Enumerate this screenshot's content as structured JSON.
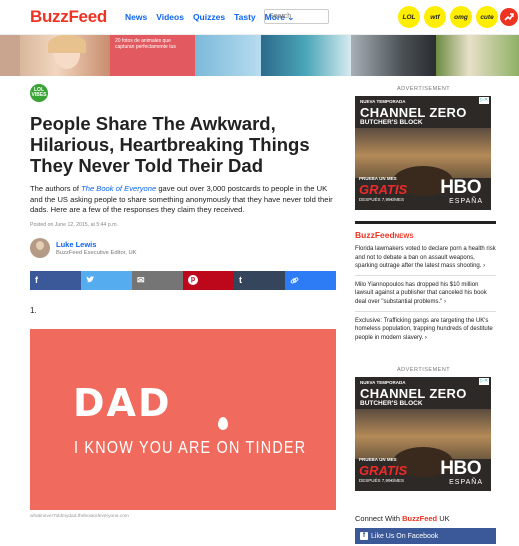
{
  "header": {
    "logo": "BuzzFeed",
    "nav": [
      "News",
      "Videos",
      "Quizzes",
      "Tasty",
      "More ⌄"
    ],
    "search_placeholder": "Search",
    "badges": [
      "LOL",
      "wtf",
      "omg",
      "cute"
    ],
    "colors": {
      "brand": "#ee3322",
      "link": "#0f65ef",
      "badge": "#ffee00"
    }
  },
  "strip": {
    "caption": "20 fotos de animales que capturan perfectamente tus"
  },
  "article": {
    "badge": "LOL VIBES",
    "title": "People Share The Awkward, Hilarious, Heartbreaking Things They Never Told Their Dad",
    "dek_before": "The authors of ",
    "dek_book": "The Book of Everyone",
    "dek_after": " gave out over 3,000 postcards to people in the UK and the US asking people to share something anonymously that they have never told their dads. Here are a few of the responses they claim they received.",
    "posted": "Posted on June 12, 2015, at 5:44 p.m.",
    "author": "Luke Lewis",
    "role": "BuzzFeed Executive Editor, UK",
    "share_buttons": [
      {
        "icon": "facebook-icon",
        "glyph": "f",
        "color": "#3b5998"
      },
      {
        "icon": "twitter-icon",
        "glyph": "🐦",
        "color": "#55acee"
      },
      {
        "icon": "email-icon",
        "glyph": "✉",
        "color": "#757575"
      },
      {
        "icon": "pinterest-icon",
        "glyph": "P",
        "color": "#bd081c"
      },
      {
        "icon": "tumblr-icon",
        "glyph": "t",
        "color": "#35465c"
      },
      {
        "icon": "link-icon",
        "glyph": "🔗",
        "color": "#2e7bf6"
      }
    ],
    "item_number": "1.",
    "image_line1": "DAD",
    "image_line2": "I KNOW YOU ARE ON TINDER",
    "credit": "whatineverToldmydad.thebookofeveryone.com",
    "image_bg": "#f06b5d"
  },
  "sidebar": {
    "ad_label": "ADVERTISEMENT",
    "ad": {
      "kicker": "NUEVA TEMPORADA",
      "show": "CHANNEL ZERO",
      "sub": "BUTCHER'S BLOCK",
      "promo": "PRUEBA UN MES",
      "gratis": "GRATIS",
      "price": "DESPUÉS 7,99€/MES",
      "network": "HBO",
      "country": "ESPAÑA",
      "adchoice": "▷✕"
    },
    "news_head_1": "BuzzFeed",
    "news_head_2": "NEWS",
    "news": [
      "Florida lawmakers voted to declare porn a health risk and not to debate a ban on assault weapons, sparking outrage after the latest mass shooting. ›",
      "Milo Yiannopoulos has dropped his $10 million lawsuit against a publisher that canceled his book deal over \"substantial problems.\" ›",
      "Exclusive: Trafficking gangs are targeting the UK's homeless population, trapping hundreds of destitute people in modern slavery. ›"
    ],
    "connect_before": "Connect With ",
    "connect_brand": "BuzzFeed",
    "connect_after": " UK",
    "facebook_button": "Like Us On Facebook"
  }
}
